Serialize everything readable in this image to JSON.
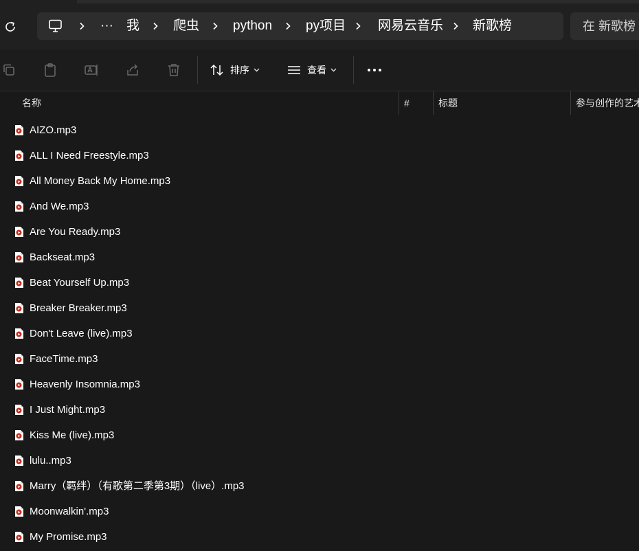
{
  "breadcrumb": {
    "items": [
      "我",
      "爬虫",
      "python",
      "py项目",
      "网易云音乐",
      "新歌榜"
    ]
  },
  "search": {
    "placeholder": "在 新歌榜 中"
  },
  "toolbar": {
    "sort_label": "排序",
    "view_label": "查看"
  },
  "columns": {
    "name": "名称",
    "number": "#",
    "title": "标题",
    "artists": "参与创作的艺术家"
  },
  "files": [
    "AIZO.mp3",
    "ALL I Need Freestyle.mp3",
    "All Money Back My Home.mp3",
    "And We.mp3",
    "Are You Ready.mp3",
    "Backseat.mp3",
    "Beat Yourself Up.mp3",
    "Breaker Breaker.mp3",
    "Don't Leave (live).mp3",
    "FaceTime.mp3",
    "Heavenly Insomnia.mp3",
    "I Just Might.mp3",
    "Kiss Me (live).mp3",
    "lulu..mp3",
    "Marry（羁绊）（有歌第二季第3期）（live）.mp3",
    "Moonwalkin'.mp3",
    "My Promise.mp3"
  ],
  "colors": {
    "background": "#191919",
    "address_bar": "#2d2d2d",
    "file_icon_accent": "#c42b1c"
  }
}
